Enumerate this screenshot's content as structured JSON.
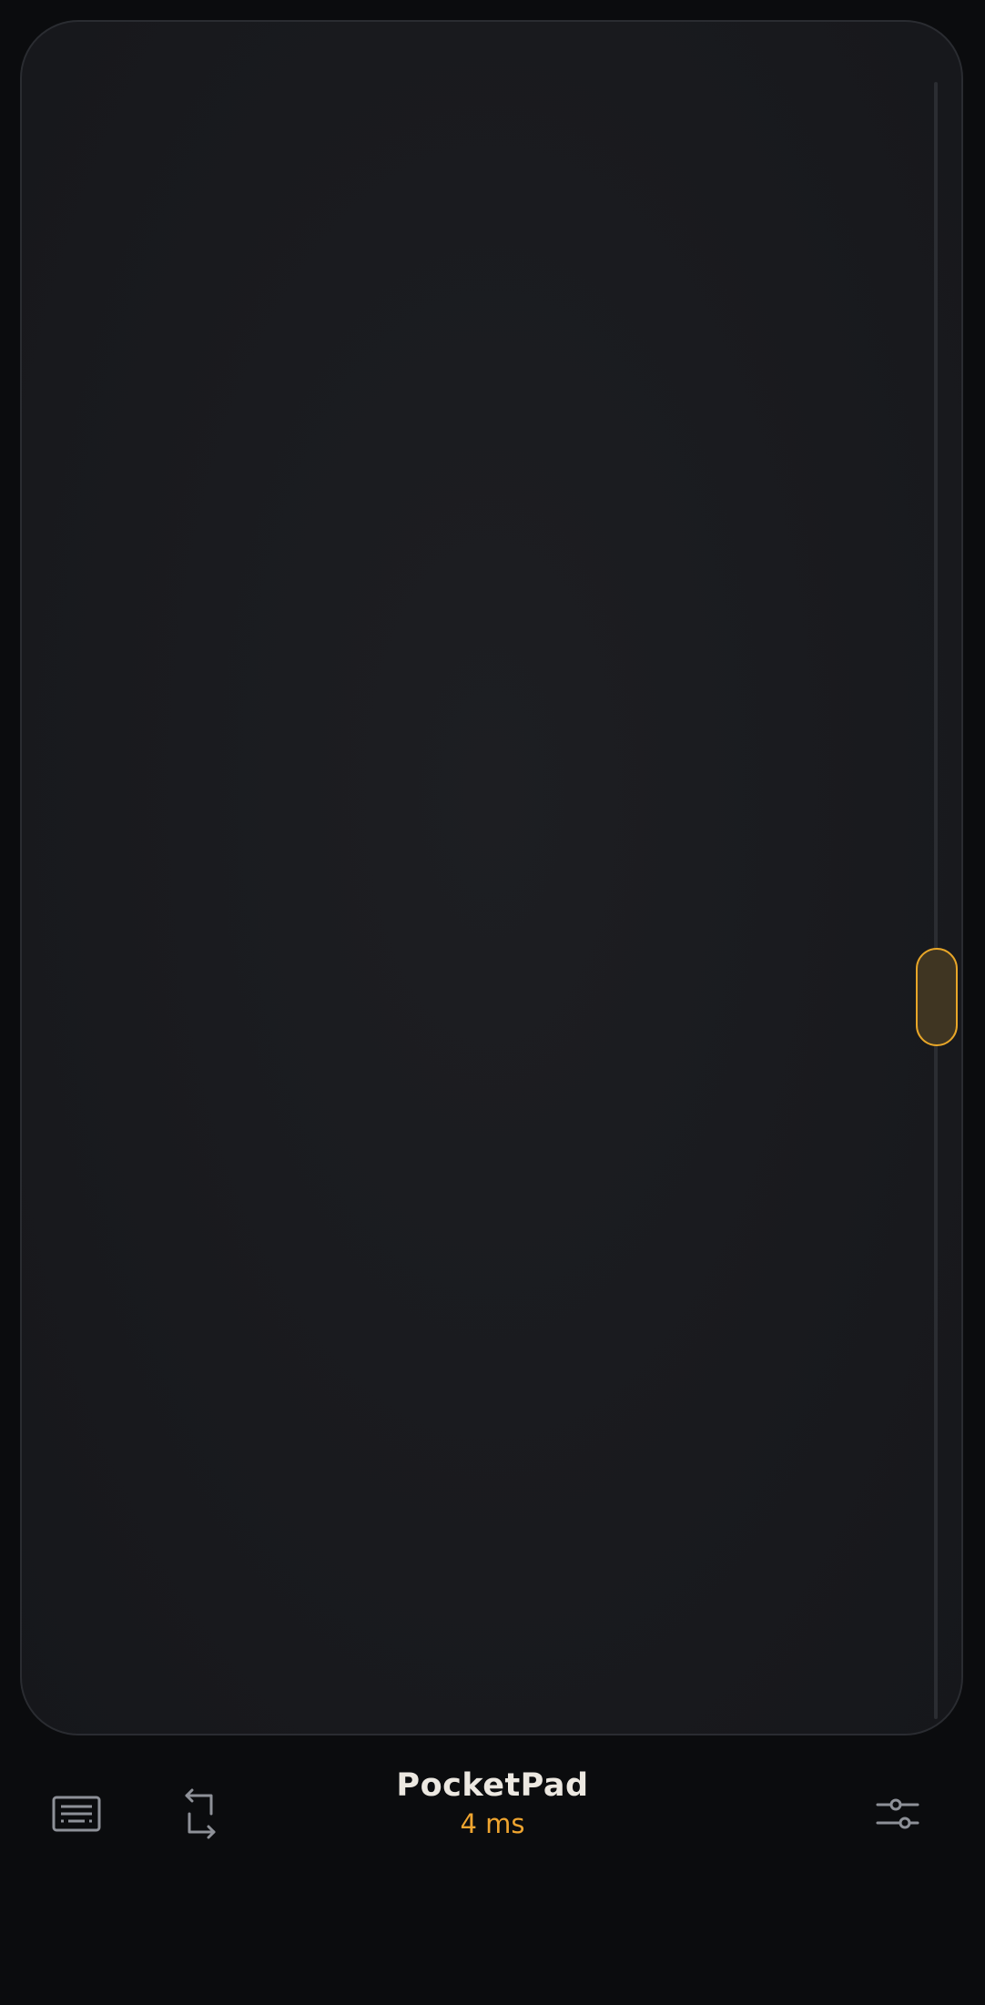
{
  "app": {
    "title": "PocketPad",
    "latency": "4 ms"
  },
  "toolbar": {
    "left_icons": [
      "keyboard-icon",
      "rotate-icon"
    ],
    "right_icons": [
      "sliders-icon"
    ]
  },
  "colors": {
    "background": "#0b0c0e",
    "touchpad_surface": "#1a1b1f",
    "touchpad_border": "#2a2c31",
    "accent": "#e8a628",
    "title_text": "#ece8e1",
    "icon": "#8e9198"
  }
}
